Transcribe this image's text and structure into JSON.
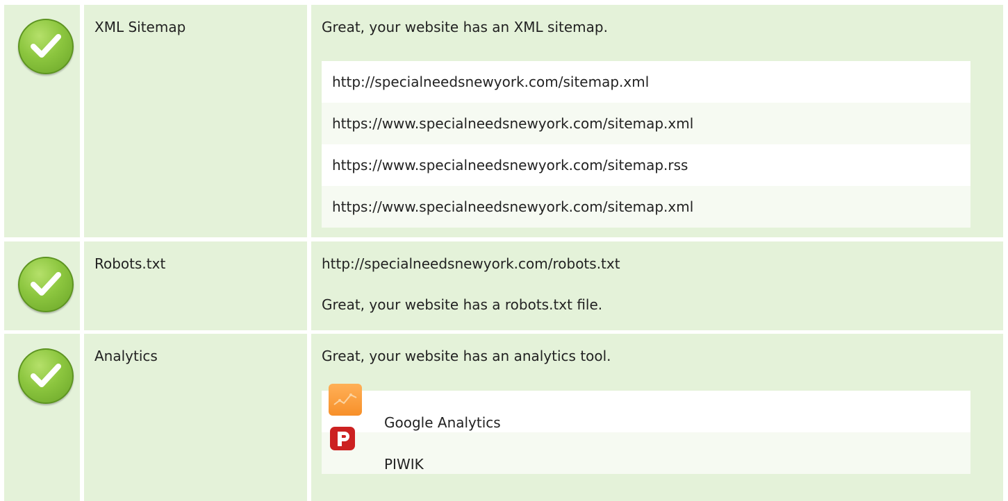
{
  "checks": [
    {
      "name": "XML Sitemap",
      "status": "pass",
      "description": "Great, your website has an XML sitemap.",
      "sitemaps": [
        "http://specialneedsnewyork.com/sitemap.xml",
        "https://www.specialneedsnewyork.com/sitemap.xml",
        "https://www.specialneedsnewyork.com/sitemap.rss",
        "https://www.specialneedsnewyork.com/sitemap.xml"
      ]
    },
    {
      "name": "Robots.txt",
      "status": "pass",
      "url": "http://specialneedsnewyork.com/robots.txt",
      "description": "Great, your website has a robots.txt file."
    },
    {
      "name": "Analytics",
      "status": "pass",
      "description": "Great, your website has an analytics tool.",
      "tools": [
        {
          "label": "Google Analytics",
          "icon": "google-analytics-icon"
        },
        {
          "label": "PIWIK",
          "icon": "piwik-icon"
        }
      ]
    }
  ],
  "colors": {
    "row_background": "#e4f2d9",
    "check_green": "#8cc63f",
    "analytics_orange": "#f7902a",
    "piwik_red": "#cc2121"
  }
}
